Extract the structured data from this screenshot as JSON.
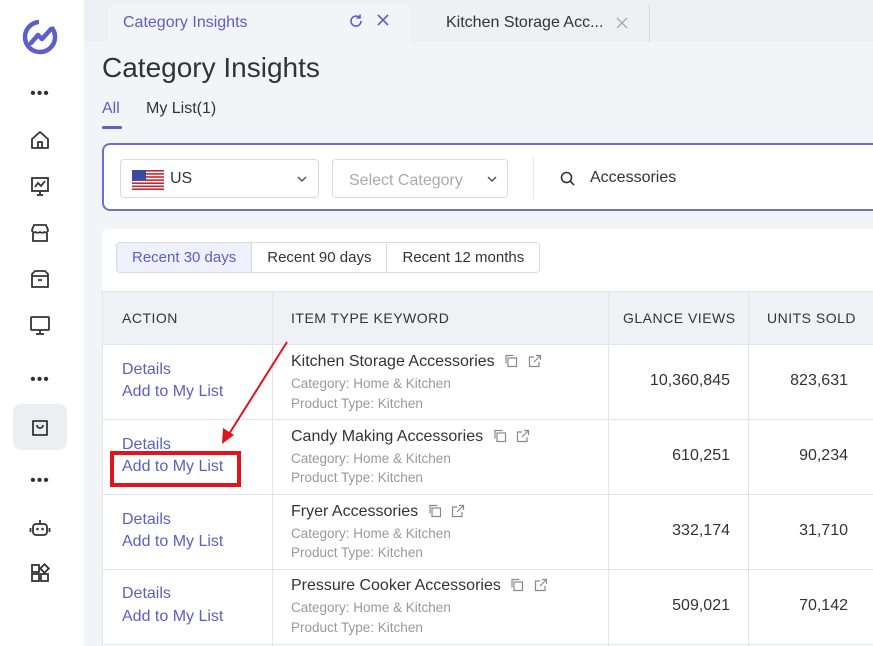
{
  "rail": {
    "icons": [
      "logo-icon",
      "home-icon",
      "trend-chart-icon",
      "store-icon",
      "package-icon",
      "monitor-icon",
      "shopping-bag-icon",
      "robot-icon",
      "apps-icon"
    ]
  },
  "tabs": [
    {
      "label": "Category Insights",
      "active": true
    },
    {
      "label": "Kitchen Storage Acc...",
      "active": false
    }
  ],
  "page": {
    "title": "Category Insights",
    "subtabs": [
      "All",
      "My List(1)"
    ]
  },
  "filter": {
    "country": "US",
    "category_placeholder": "Select Category",
    "search": "Accessories"
  },
  "time_range": {
    "options": [
      "Recent 30 days",
      "Recent 90 days",
      "Recent 12 months"
    ],
    "selected": "Recent 30 days"
  },
  "table": {
    "headers": {
      "action": "ACTION",
      "keyword": "ITEM TYPE KEYWORD",
      "glance_views": "GLANCE VIEWS",
      "units_sold": "UNITS SOLD"
    },
    "rows": [
      {
        "details": "Details",
        "add": "Add to My List",
        "keyword": "Kitchen Storage Accessories",
        "category": "Category: Home & Kitchen",
        "product_type": "Product Type: Kitchen",
        "glance_views": "10,360,845",
        "units_sold": "823,631"
      },
      {
        "details": "Details",
        "add": "Add to My List",
        "keyword": "Candy Making Accessories",
        "category": "Category: Home & Kitchen",
        "product_type": "Product Type: Kitchen",
        "glance_views": "610,251",
        "units_sold": "90,234"
      },
      {
        "details": "Details",
        "add": "Add to My List",
        "keyword": "Fryer Accessories",
        "category": "Category: Home & Kitchen",
        "product_type": "Product Type: Kitchen",
        "glance_views": "332,174",
        "units_sold": "31,710"
      },
      {
        "details": "Details",
        "add": "Add to My List",
        "keyword": "Pressure Cooker Accessories",
        "category": "Category: Home & Kitchen",
        "product_type": "Product Type: Kitchen",
        "glance_views": "509,021",
        "units_sold": "70,142"
      }
    ]
  },
  "colors": {
    "accent": "#5b5fc7",
    "annotation": "#e0141b"
  }
}
